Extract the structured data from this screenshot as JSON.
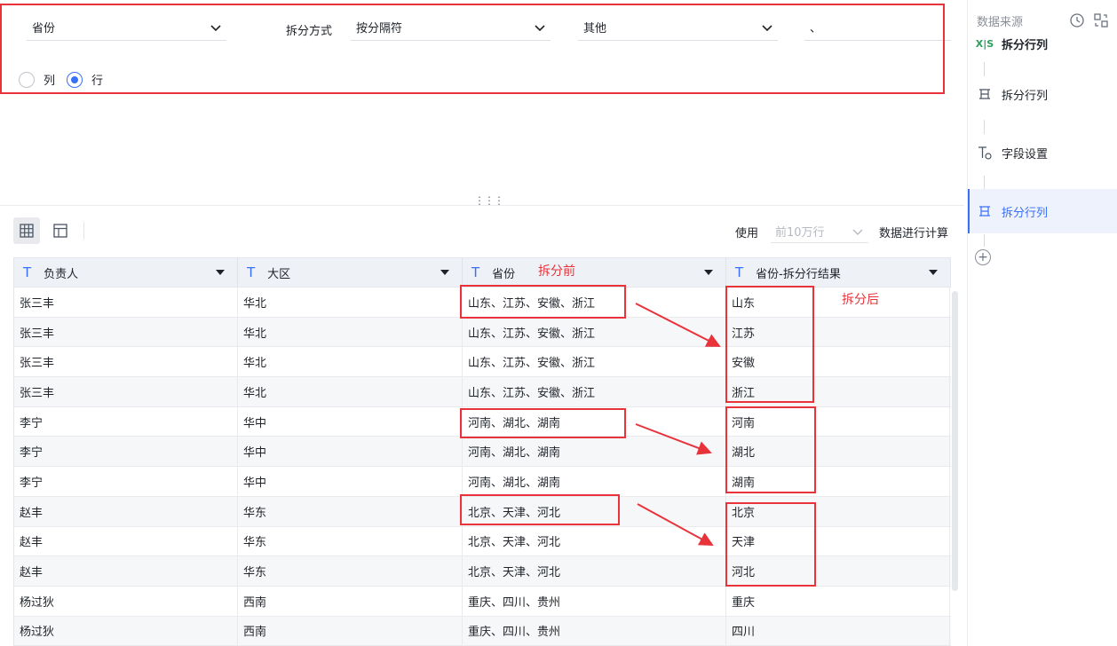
{
  "config": {
    "field_select": "省份",
    "split_method_label": "拆分方式",
    "split_method_select": "按分隔符",
    "delimiter_select": "其他",
    "delimiter_input": "、",
    "direction_options": [
      {
        "label": "列",
        "checked": false
      },
      {
        "label": "行",
        "checked": true
      }
    ]
  },
  "toolbar": {
    "use_label": "使用",
    "rows_select_placeholder": "前10万行",
    "compute_label": "数据进行计算"
  },
  "table": {
    "columns": [
      {
        "label": "负责人",
        "type_icon": "T"
      },
      {
        "label": "大区",
        "type_icon": "T"
      },
      {
        "label": "省份",
        "type_icon": "T"
      },
      {
        "label": "省份-拆分行结果",
        "type_icon": "T"
      }
    ],
    "rows": [
      [
        "张三丰",
        "华北",
        "山东、江苏、安徽、浙江",
        "山东"
      ],
      [
        "张三丰",
        "华北",
        "山东、江苏、安徽、浙江",
        "江苏"
      ],
      [
        "张三丰",
        "华北",
        "山东、江苏、安徽、浙江",
        "安徽"
      ],
      [
        "张三丰",
        "华北",
        "山东、江苏、安徽、浙江",
        "浙江"
      ],
      [
        "李宁",
        "华中",
        "河南、湖北、湖南",
        "河南"
      ],
      [
        "李宁",
        "华中",
        "河南、湖北、湖南",
        "湖北"
      ],
      [
        "李宁",
        "华中",
        "河南、湖北、湖南",
        "湖南"
      ],
      [
        "赵丰",
        "华东",
        "北京、天津、河北",
        "北京"
      ],
      [
        "赵丰",
        "华东",
        "北京、天津、河北",
        "天津"
      ],
      [
        "赵丰",
        "华东",
        "北京、天津、河北",
        "河北"
      ],
      [
        "杨过狄",
        "西南",
        "重庆、四川、贵州",
        "重庆"
      ],
      [
        "杨过狄",
        "西南",
        "重庆、四川、贵州",
        "四川"
      ]
    ]
  },
  "annotations": {
    "before": "拆分前",
    "after": "拆分后",
    "color": "#e8333a"
  },
  "sidebar": {
    "title": "数据来源",
    "nodes": [
      {
        "label": "拆分行列",
        "icon": "xls-icon",
        "bold": true,
        "active": false
      },
      {
        "label": "拆分行列",
        "icon": "split-icon",
        "bold": false,
        "active": false
      },
      {
        "label": "字段设置",
        "icon": "field-settings-icon",
        "bold": false,
        "active": false
      },
      {
        "label": "拆分行列",
        "icon": "split-icon",
        "bold": false,
        "active": true
      }
    ],
    "add_label": "+"
  },
  "colors": {
    "accent": "#3a6ff7",
    "annotation": "#e8333a",
    "header_bg": "#eef1f6"
  }
}
